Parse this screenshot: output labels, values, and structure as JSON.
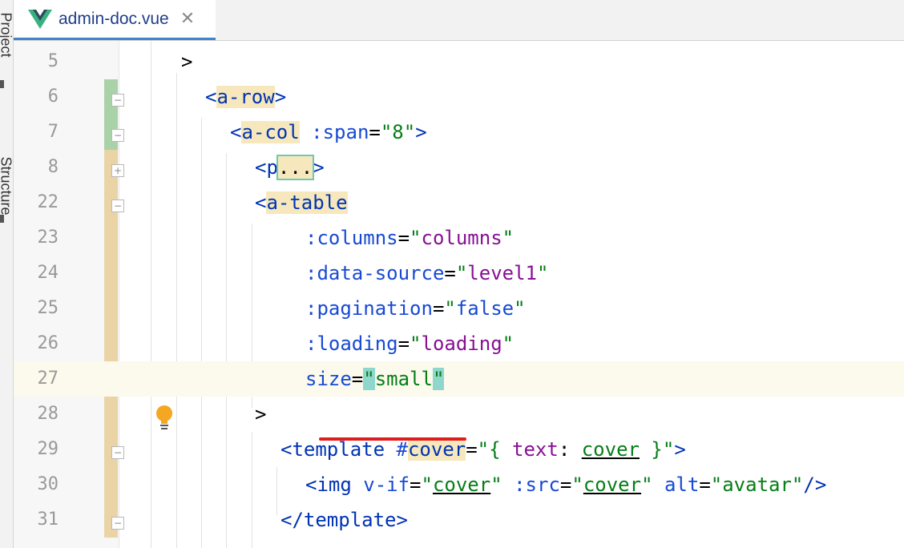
{
  "sidebar": {
    "project_label": "Project",
    "structure_label": "Structure"
  },
  "tab": {
    "icon": "vue-logo-icon",
    "filename": "admin-doc.vue",
    "close_glyph": "✕"
  },
  "colors": {
    "tag": "#0033b3",
    "attr": "#174ad4",
    "string": "#067d17",
    "variable": "#871094",
    "tag_highlight": "#f6e8bc",
    "line_highlight": "#fcfaed",
    "error_underline": "#e01d1d"
  },
  "lines": [
    {
      "num": "5",
      "parts": [
        [
          "p",
          ">"
        ]
      ]
    },
    {
      "num": "6",
      "parts": [
        [
          "t",
          "<"
        ],
        [
          "tb",
          "a-row"
        ],
        [
          "t",
          ">"
        ]
      ]
    },
    {
      "num": "7",
      "parts": [
        [
          "t",
          "<"
        ],
        [
          "tb",
          "a-col"
        ],
        [
          "p",
          " "
        ],
        [
          "a",
          ":span"
        ],
        [
          "p",
          "="
        ],
        [
          "s",
          "\"8\""
        ],
        [
          "t",
          ">"
        ]
      ]
    },
    {
      "num": "8",
      "parts": [
        [
          "t",
          "<p"
        ],
        [
          "cb",
          "..."
        ],
        [
          "t",
          ">"
        ]
      ]
    },
    {
      "num": "22",
      "parts": [
        [
          "t",
          "<"
        ],
        [
          "tb",
          "a-table"
        ]
      ]
    },
    {
      "num": "23",
      "parts": [
        [
          "a",
          ":columns"
        ],
        [
          "p",
          "="
        ],
        [
          "s",
          "\""
        ],
        [
          "v",
          "columns"
        ],
        [
          "s",
          "\""
        ]
      ]
    },
    {
      "num": "24",
      "parts": [
        [
          "a",
          ":data-source"
        ],
        [
          "p",
          "="
        ],
        [
          "s",
          "\""
        ],
        [
          "v",
          "level1"
        ],
        [
          "s",
          "\""
        ]
      ]
    },
    {
      "num": "25",
      "parts": [
        [
          "a",
          ":pagination"
        ],
        [
          "p",
          "="
        ],
        [
          "s",
          "\""
        ],
        [
          "a",
          "false"
        ],
        [
          "s",
          "\""
        ]
      ]
    },
    {
      "num": "26",
      "parts": [
        [
          "a",
          ":loading"
        ],
        [
          "p",
          "="
        ],
        [
          "s",
          "\""
        ],
        [
          "v",
          "loading"
        ],
        [
          "s",
          "\""
        ]
      ]
    },
    {
      "num": "27",
      "parts": [
        [
          "a",
          "size"
        ],
        [
          "p",
          "="
        ],
        [
          "qh",
          "\""
        ],
        [
          "s",
          "small"
        ],
        [
          "qh",
          "\""
        ]
      ]
    },
    {
      "num": "28",
      "parts": [
        [
          "p",
          ">"
        ]
      ]
    },
    {
      "num": "29",
      "parts": [
        [
          "t",
          "<template "
        ],
        [
          "a",
          "#"
        ],
        [
          "tb",
          "cover"
        ],
        [
          "p",
          "="
        ],
        [
          "s",
          "\"{ "
        ],
        [
          "v",
          "text"
        ],
        [
          "p",
          ": "
        ],
        [
          "u",
          "cover"
        ],
        [
          "s",
          " }\""
        ],
        [
          "t",
          ">"
        ]
      ]
    },
    {
      "num": "30",
      "parts": [
        [
          "t",
          "<img "
        ],
        [
          "a",
          "v-if"
        ],
        [
          "p",
          "="
        ],
        [
          "s",
          "\""
        ],
        [
          "u",
          "cover"
        ],
        [
          "s",
          "\""
        ],
        [
          "p",
          " "
        ],
        [
          "a",
          ":src"
        ],
        [
          "p",
          "="
        ],
        [
          "s",
          "\""
        ],
        [
          "u",
          "cover"
        ],
        [
          "s",
          "\""
        ],
        [
          "p",
          " "
        ],
        [
          "a",
          "alt"
        ],
        [
          "p",
          "="
        ],
        [
          "s",
          "\"avatar\""
        ],
        [
          "t",
          "/>"
        ]
      ]
    },
    {
      "num": "31",
      "parts": [
        [
          "t",
          "</template>"
        ]
      ]
    }
  ]
}
